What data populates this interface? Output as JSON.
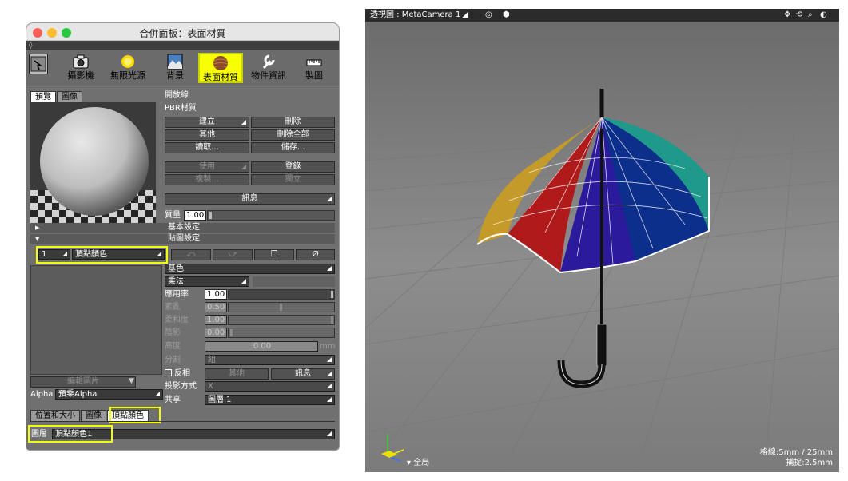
{
  "window": {
    "title": "合併面板：表面材質"
  },
  "toolbar": {
    "items": [
      {
        "label": "攝影機",
        "icon": "camera-icon"
      },
      {
        "label": "無限光源",
        "icon": "sun-icon"
      },
      {
        "label": "背景",
        "icon": "landscape-icon"
      },
      {
        "label": "表面材質",
        "icon": "material-sphere-icon"
      },
      {
        "label": "物件資訊",
        "icon": "wrench-icon"
      },
      {
        "label": "製圖",
        "icon": "ruler-icon"
      }
    ]
  },
  "preview_tabs": [
    "預覽",
    "圖像"
  ],
  "material": {
    "name": "開放線",
    "type": "PBR材質",
    "btn_create": "建立",
    "btn_delete": "刪除",
    "btn_other": "其他",
    "btn_delete_all": "刪除全部",
    "btn_load": "讀取...",
    "btn_save": "儲存...",
    "btn_use": "使用",
    "btn_register": "登錄",
    "btn_duplicate": "複製...",
    "btn_independent": "獨立",
    "btn_message": "訊息",
    "mass_label": "質量",
    "mass_value": "1.00"
  },
  "sections": {
    "basic": "基本設定",
    "mapping": "貼圖設定"
  },
  "map": {
    "layer_index": "1",
    "layer_type": "頂點顏色",
    "tool_undo": "⤺",
    "tool_redo": "⤻",
    "tool_copy": "❐",
    "tool_clear": "Ø",
    "attribute": "基色",
    "blend": "乘法",
    "apply_label": "應用率",
    "apply_value": "1.00",
    "noise_label": "紊亂",
    "noise_value": "0.50",
    "soft_label": "柔和度",
    "soft_value": "1.00",
    "shadow_label": "陰影",
    "shadow_value": "0.00",
    "height_label": "高度",
    "height_value": "0.00",
    "height_unit": "mm",
    "split_label": "分割",
    "split_value": "組",
    "invert_label": "反相",
    "other_btn": "其他",
    "message_btn": "訊息",
    "projection_label": "投影方式",
    "projection_value": "X",
    "share_label": "共享",
    "share_value": "圖層 1",
    "edit_image": "編輯圖片",
    "alpha_label": "Alpha",
    "alpha_value": "預乘Alpha"
  },
  "bottom_tabs": [
    "位置和大小",
    "圖像",
    "頂點顏色"
  ],
  "layer_row": {
    "label": "圖層",
    "value": "頂點顏色1"
  },
  "viewport": {
    "title": "透視圖 : MetaCamera 1",
    "global_label": "全局",
    "grid_text": "格線:5mm / 25mm",
    "snap_text": "捕捉:2.5mm",
    "panel_colors": [
      "#c49a2a",
      "#b01a1a",
      "#2b1a9c",
      "#0b2f8a",
      "#1f9a8a"
    ]
  }
}
